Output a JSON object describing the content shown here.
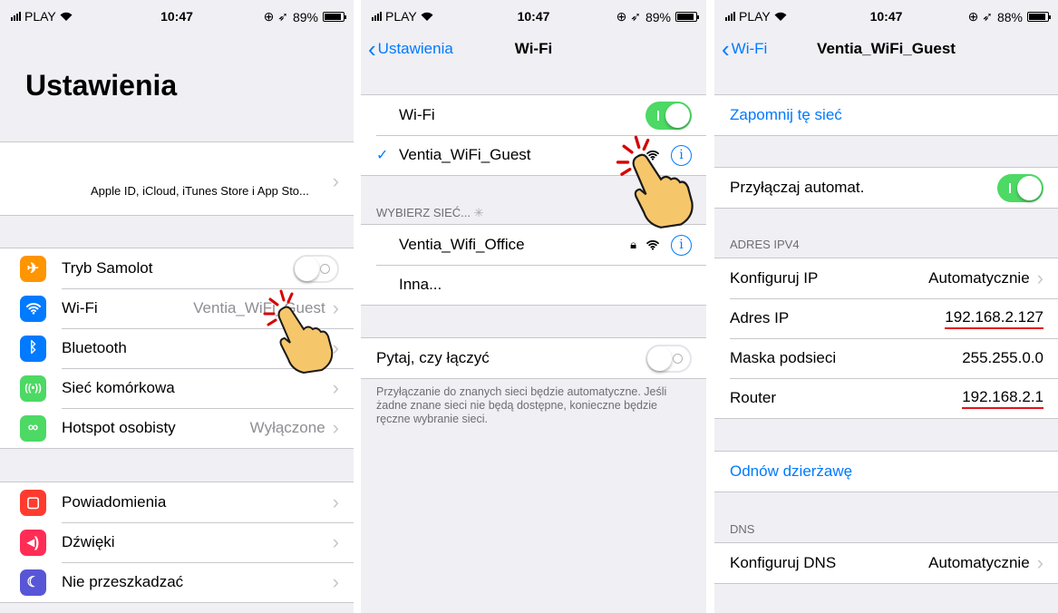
{
  "status_left": {
    "carrier": "PLAY",
    "time": "10:47",
    "battery": "89%"
  },
  "status_mid": {
    "carrier": "PLAY",
    "time": "10:47",
    "battery": "89%"
  },
  "status_right": {
    "carrier": "PLAY",
    "time": "10:47",
    "battery": "88%"
  },
  "settings": {
    "title": "Ustawienia",
    "apple_id": "Apple ID, iCloud, iTunes Store i App Sto...",
    "items": [
      {
        "label": "Tryb Samolot",
        "value": "",
        "color": "#ff9500",
        "icon": "airplane-icon"
      },
      {
        "label": "Wi-Fi",
        "value": "Ventia_WiFi_Guest",
        "color": "#007aff",
        "icon": "wifi-icon"
      },
      {
        "label": "Bluetooth",
        "value": "",
        "color": "#007aff",
        "icon": "bluetooth-icon"
      },
      {
        "label": "Sieć komórkowa",
        "value": "",
        "color": "#4cd964",
        "icon": "cellular-icon"
      },
      {
        "label": "Hotspot osobisty",
        "value": "Wyłączone",
        "color": "#4cd964",
        "icon": "hotspot-icon"
      }
    ],
    "items2": [
      {
        "label": "Powiadomienia",
        "color": "#ff3b30",
        "icon": "notifications-icon"
      },
      {
        "label": "Dźwięki",
        "color": "#ff2d55",
        "icon": "sounds-icon"
      },
      {
        "label": "Nie przeszkadzać",
        "color": "#5856d6",
        "icon": "moon-icon"
      }
    ]
  },
  "wifi": {
    "back": "Ustawienia",
    "title": "Wi-Fi",
    "wifi_label": "Wi-Fi",
    "connected": "Ventia_WiFi_Guest",
    "choose_header": "WYBIERZ SIEĆ...",
    "networks": [
      {
        "name": "Ventia_Wifi_Office"
      }
    ],
    "other": "Inna...",
    "ask_label": "Pytaj, czy łączyć",
    "ask_footer": "Przyłączanie do znanych sieci będzie automatyczne. Jeśli żadne znane sieci nie będą dostępne, konieczne będzie ręczne wybranie sieci."
  },
  "network": {
    "back": "Wi-Fi",
    "title": "Ventia_WiFi_Guest",
    "forget": "Zapomnij tę sieć",
    "auto_join": "Przyłączaj automat.",
    "ipv4_header": "ADRES IPV4",
    "ipv4": [
      {
        "label": "Konfiguruj IP",
        "value": "Automatycznie",
        "chev": true
      },
      {
        "label": "Adres IP",
        "value": "192.168.2.127",
        "underline": true
      },
      {
        "label": "Maska podsieci",
        "value": "255.255.0.0"
      },
      {
        "label": "Router",
        "value": "192.168.2.1",
        "underline": true
      }
    ],
    "renew": "Odnów dzierżawę",
    "dns_header": "DNS",
    "dns_label": "Konfiguruj DNS",
    "dns_value": "Automatycznie"
  }
}
